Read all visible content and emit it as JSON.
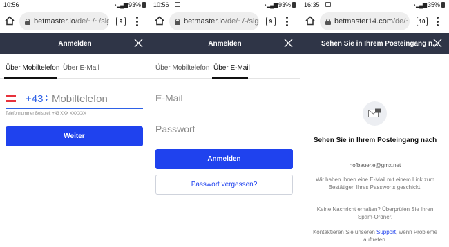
{
  "panels": [
    {
      "status": {
        "time": "10:56",
        "battery": "93%"
      },
      "browser": {
        "url_domain": "betmaster.io",
        "url_path": "/de/~/~/sig",
        "tab_count": "9"
      },
      "header": {
        "title": "Anmelden"
      },
      "tabs": [
        {
          "label": "Über Mobiltelefon",
          "active": true
        },
        {
          "label": "Über E-Mail",
          "active": false
        }
      ],
      "form": {
        "country_code": "+43",
        "phone_placeholder": "Mobiltelefon",
        "hint": "Telefonnummer Beispiel: +43 XXX XXXXXX",
        "submit_label": "Weiter"
      }
    },
    {
      "status": {
        "time": "10:56",
        "battery": "93%"
      },
      "browser": {
        "url_domain": "betmaster.io",
        "url_path": "/de/~/-/sig",
        "tab_count": "9"
      },
      "header": {
        "title": "Anmelden"
      },
      "tabs": [
        {
          "label": "Über Mobiltelefon",
          "active": false
        },
        {
          "label": "Über E-Mail",
          "active": true
        }
      ],
      "form": {
        "email_placeholder": "E-Mail",
        "password_placeholder": "Passwort",
        "submit_label": "Anmelden",
        "forgot_label": "Passwort vergessen?"
      }
    },
    {
      "status": {
        "time": "16:35",
        "battery": "35%"
      },
      "browser": {
        "url_domain": "betmaster14.com",
        "url_path": "/de/~",
        "tab_count": "10"
      },
      "header": {
        "title": "Sehen Sie in Ihrem Posteingang n..."
      },
      "confirmation": {
        "title": "Sehen Sie in Ihrem Posteingang nach",
        "email": "hofbauer.e@gmx.net",
        "message": "Wir haben Ihnen eine E-Mail mit einem Link zum Bestätigen Ihres Passworts geschickt.",
        "spam_note": "Keine Nachricht erhalten? Überprüfen Sie Ihren Spam-Ordner.",
        "support_prefix": "Kontaktieren Sie unseren ",
        "support_link": "Support",
        "support_suffix": ", wenn Probleme auftreten."
      }
    }
  ],
  "colors": {
    "header_bg": "#2f3547",
    "primary": "#1f42ee",
    "input_underline": "#2e61e6",
    "flag_red": "#e7323c"
  },
  "icons": [
    "home-icon",
    "lock-icon",
    "tabs-icon",
    "menu-icon",
    "close-icon",
    "austria-flag-icon",
    "mail-icon"
  ]
}
